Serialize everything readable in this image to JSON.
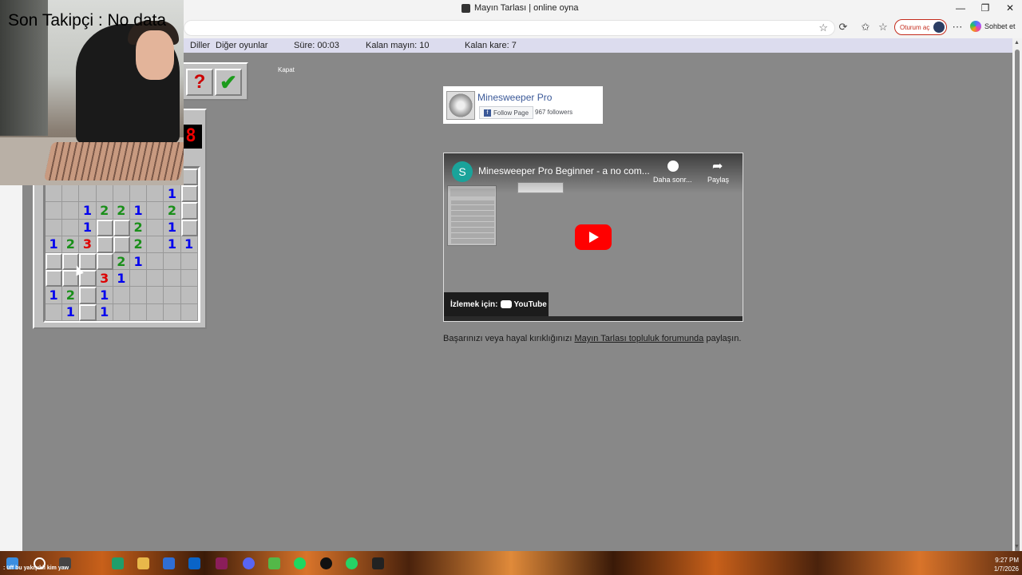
{
  "window": {
    "title": "Mayın Tarlası | online oyna",
    "controls": [
      "—",
      "❐",
      "✕"
    ]
  },
  "toolbar": {
    "signin_label": "Oturum aç",
    "copilot_label": "Sohbet et",
    "icons": [
      "star-icon",
      "extensions-icon",
      "favorites-icon",
      "collections-icon",
      "more-icon"
    ]
  },
  "menubar": {
    "items": [
      "Diller",
      "Diğer oyunlar"
    ],
    "time_label": "Süre: 00:03",
    "mines_left_label": "Kalan mayın: 10",
    "cells_left_label": "Kalan kare: 7"
  },
  "close_label": "Kapat",
  "game": {
    "counter_right": "8",
    "help_icon": "?",
    "check_icon": "✔",
    "grid": [
      [
        "h",
        "h",
        "h",
        "h",
        "h",
        "h",
        "h",
        "h",
        "h"
      ],
      [
        "",
        "",
        "",
        "",
        "",
        "",
        "",
        "1",
        "h"
      ],
      [
        "",
        "",
        "1",
        "2",
        "2",
        "1",
        "",
        "2",
        "h"
      ],
      [
        "",
        "",
        "1",
        "h",
        "h",
        "2",
        "",
        "1",
        "h"
      ],
      [
        "1",
        "2",
        "3",
        "h",
        "h",
        "2",
        "",
        "1",
        "1"
      ],
      [
        "h",
        "h",
        "h",
        "h",
        "2",
        "1",
        "",
        "",
        ""
      ],
      [
        "h",
        "h",
        "h",
        "3",
        "1",
        "",
        "",
        "",
        ""
      ],
      [
        "1",
        "2",
        "h",
        "1",
        "",
        "",
        "",
        "",
        ""
      ],
      [
        "",
        "1",
        "h",
        "1",
        "",
        "",
        "",
        "",
        ""
      ]
    ]
  },
  "webcam": {
    "overlay_text": "Son Takipçi : No data"
  },
  "facebook": {
    "page_name": "Minesweeper Pro",
    "follow_label": "Follow Page",
    "followers": "967 followers"
  },
  "video": {
    "channel_initial": "S",
    "title": "Minesweeper Pro Beginner - a no com...",
    "later_label": "Daha sonr...",
    "share_label": "Paylaş",
    "watch_label": "İzlemek için:",
    "youtube_label": "YouTube"
  },
  "share": {
    "prefix": "Başarınızı veya hayal kırıklığınızı ",
    "link": "Mayın Tarlası topluluk forumunda",
    "suffix": " paylaşın."
  },
  "taskbar": {
    "chat_text": ": üff bu yakışıklı kim yaw",
    "time": "9:27 PM",
    "date": "1/7/2026"
  },
  "colors": {
    "page_bg": "#888888",
    "menubar_bg": "#dcdcee",
    "num1": "#0000ee",
    "num2": "#1a8f1a",
    "num3": "#dd0000",
    "accent": "#c42b1c"
  }
}
